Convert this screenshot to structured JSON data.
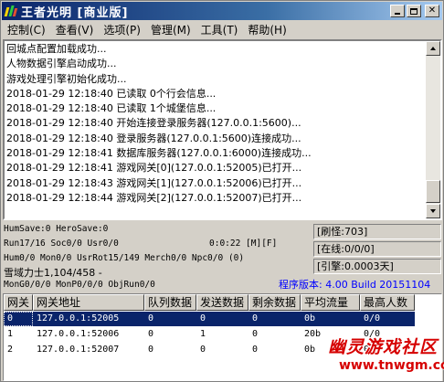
{
  "window": {
    "title": "王者光明 [商业版]"
  },
  "menu": [
    "控制(C)",
    "查看(V)",
    "选项(P)",
    "管理(M)",
    "工具(T)",
    "帮助(H)"
  ],
  "log": [
    "回城点配置加载成功...",
    "人物数据引擎启动成功...",
    "游戏处理引擎初始化成功...",
    "2018-01-29 12:18:40 已读取 0个行会信息...",
    "2018-01-29 12:18:40 已读取 1个城堡信息...",
    "2018-01-29 12:18:40 开始连接登录服务器(127.0.0.1:5600)...",
    "2018-01-29 12:18:40 登录服务器(127.0.0.1:5600)连接成功...",
    "2018-01-29 12:18:41 数据库服务器(127.0.0.1:6000)连接成功...",
    "2018-01-29 12:18:41 游戏网关[0](127.0.0.1:52005)已打开...",
    "2018-01-29 12:18:43 游戏网关[1](127.0.0.1:52006)已打开...",
    "2018-01-29 12:18:44 游戏网关[2](127.0.0.1:52007)已打开..."
  ],
  "status": {
    "line1": "HumSave:0 HeroSave:0",
    "line2": "Run17/16 Soc0/0 Usr0/0",
    "time": "0:0:22 [M][F]",
    "line3": "Hum0/0 Mon0/0 UsrRot15/149 Merch0/0 Npc0/0 (0)",
    "line4": "雪域力士1,104/458 -",
    "line5": "MonG0/0/0 MonP0/0/0 ObjRun0/0",
    "refresh": "[刷怪:703]",
    "online": "[在线:0/0/0]",
    "engine": "[引擎:0.0003天]",
    "version": "程序版本: 4.00 Build 20151104"
  },
  "table": {
    "columns": [
      "网关",
      "网关地址",
      "队列数据",
      "发送数据",
      "剩余数据",
      "平均流量",
      "最高人数"
    ],
    "rows": [
      [
        "0",
        "127.0.0.1:52005",
        "0",
        "0",
        "0",
        "0b",
        "0/0"
      ],
      [
        "1",
        "127.0.0.1:52006",
        "0",
        "1",
        "0",
        "20b",
        "0/0"
      ],
      [
        "2",
        "127.0.0.1:52007",
        "0",
        "0",
        "0",
        "0b",
        "0/0"
      ]
    ]
  },
  "watermark": {
    "title": "幽灵游戏社区",
    "url": "www.tnwgm.com"
  },
  "colors": {
    "titlebar_start": "#0a246a",
    "titlebar_end": "#a6caf0",
    "face": "#d4d0c8",
    "selection": "#0a246a",
    "version_text": "#0000ff",
    "watermark": "#d60000"
  }
}
